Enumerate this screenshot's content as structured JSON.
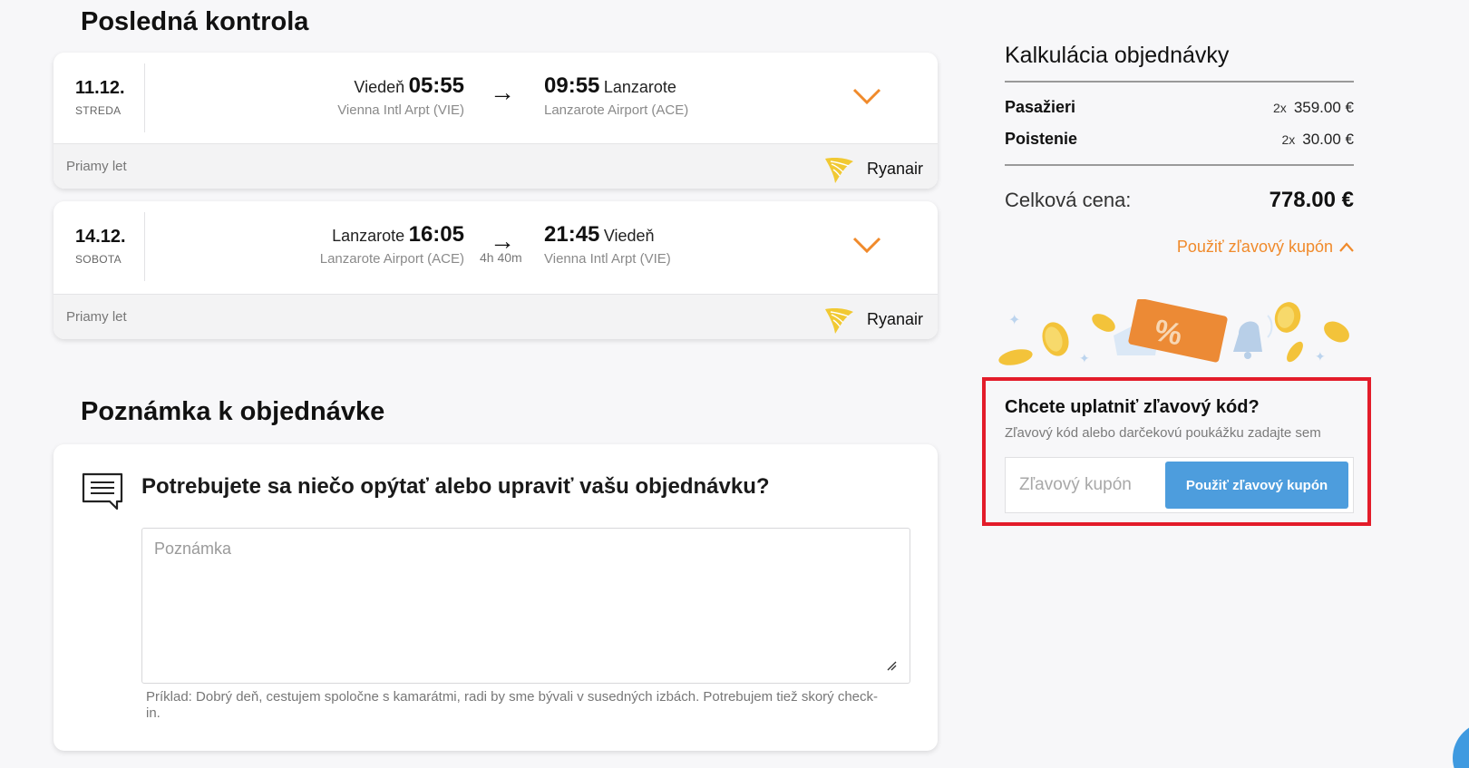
{
  "review": {
    "title": "Posledná kontrola"
  },
  "flights": [
    {
      "date": "11.12.",
      "weekday": "STREDA",
      "dep_city": "Viedeň",
      "dep_time": "05:55",
      "dep_airport": "Vienna Intl Arpt (VIE)",
      "arrow": "→",
      "duration": "",
      "arr_time": "09:55",
      "arr_city": "Lanzarote",
      "arr_airport": "Lanzarote Airport (ACE)",
      "type": "Priamy let",
      "airline": "Ryanair"
    },
    {
      "date": "14.12.",
      "weekday": "SOBOTA",
      "dep_city": "Lanzarote",
      "dep_time": "16:05",
      "dep_airport": "Lanzarote Airport (ACE)",
      "arrow": "→",
      "duration": "4h 40m",
      "arr_time": "21:45",
      "arr_city": "Viedeň",
      "arr_airport": "Vienna Intl Arpt (VIE)",
      "type": "Priamy let",
      "airline": "Ryanair"
    }
  ],
  "note": {
    "title": "Poznámka k objednávke",
    "question": "Potrebujete sa niečo opýtať alebo upraviť vašu objednávku?",
    "placeholder": "Poznámka",
    "hint": "Príklad: Dobrý deň, cestujem spoločne s kamarátmi, radi by sme bývali v susedných izbách. Potrebujem tiež skorý check-in."
  },
  "calculation": {
    "title": "Kalkulácia objednávky",
    "rows": [
      {
        "label": "Pasažieri",
        "multiplier": "2x",
        "value": "359.00 €"
      },
      {
        "label": "Poistenie",
        "multiplier": "2x",
        "value": "30.00 €"
      }
    ],
    "total_label": "Celková cena:",
    "total_value": "778.00 €",
    "coupon_toggle": "Použiť zľavový kupón"
  },
  "coupon": {
    "title": "Chcete uplatniť zľavový kód?",
    "subtitle": "Zľavový kód alebo darčekovú poukážku zadajte sem",
    "placeholder": "Zľavový kupón",
    "button": "Použiť zľavový kupón"
  },
  "colors": {
    "accent_orange": "#f08a2b",
    "button_blue": "#4d9ddd",
    "highlight_red": "#e31c2a"
  }
}
